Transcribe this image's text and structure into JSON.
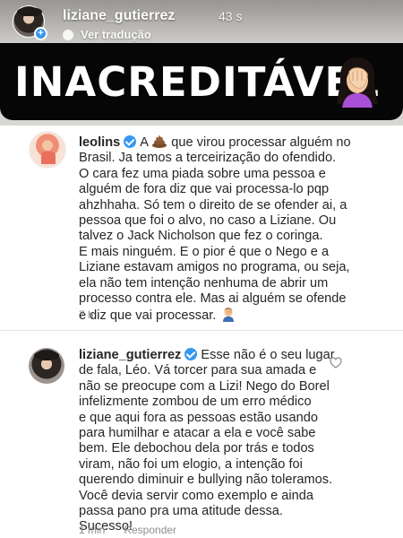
{
  "story": {
    "username": "liziane_gutierrez",
    "time": "43 s",
    "translate_label": "Ver tradução",
    "banner_text": "INACREDITÁVEL",
    "banner_emoji_icon": "facepalm-icon"
  },
  "comments": [
    {
      "username": "leolins",
      "verified": true,
      "lines": [
        {
          "after_name": "A",
          "icon": "poop-icon",
          "rest": " que virou processar alguém no"
        },
        "Brasil. Ja temos a terceirização do ofendido.",
        "O cara fez uma piada sobre uma pessoa e",
        "alguém de fora diz que vai processa-lo pqp",
        "ahzhhaha. Só tem o direito de se ofender ai, a",
        "pessoa que foi o alvo, no caso a Liziane. Ou",
        "talvez o Jack Nicholson que fez o coringa.",
        "E mais ninguém. E o pior é que o Nego e a",
        "Liziane estavam amigos no programa, ou seja,",
        "ela não tem intenção nenhuma de abrir um",
        "processo contra ele. Mas ai alguém se ofende",
        {
          "text": "e diz que vai processar.",
          "icon": "person-facepalm-icon"
        }
      ],
      "time": "7 h"
    },
    {
      "username": "liziane_gutierrez",
      "verified": true,
      "lines": [
        {
          "after_name": "Esse não é o seu lugar"
        },
        "de fala, Léo. Vá torcer para sua amada e",
        "não se preocupe com a Lizi! Nego do Borel",
        "infelizmente zombou de um erro médico",
        "e que aqui fora as pessoas estão usando",
        "para humilhar e atacar a ela e você sabe",
        "bem. Ele debochou dela por trás e todos",
        "viram, não foi um elogio, a intenção foi",
        "querendo diminuir e bullying não toleramos.",
        "Você devia servir como exemplo e ainda",
        "passa pano pra uma atitude dessa.",
        "Sucesso!"
      ],
      "time": "1 min",
      "reply_label": "Responder",
      "like_icon": "heart-outline-icon"
    }
  ],
  "colors": {
    "verified": "#3897f0",
    "text": "#262626",
    "meta": "#8e8e8e",
    "banner_bg": "#060606"
  }
}
